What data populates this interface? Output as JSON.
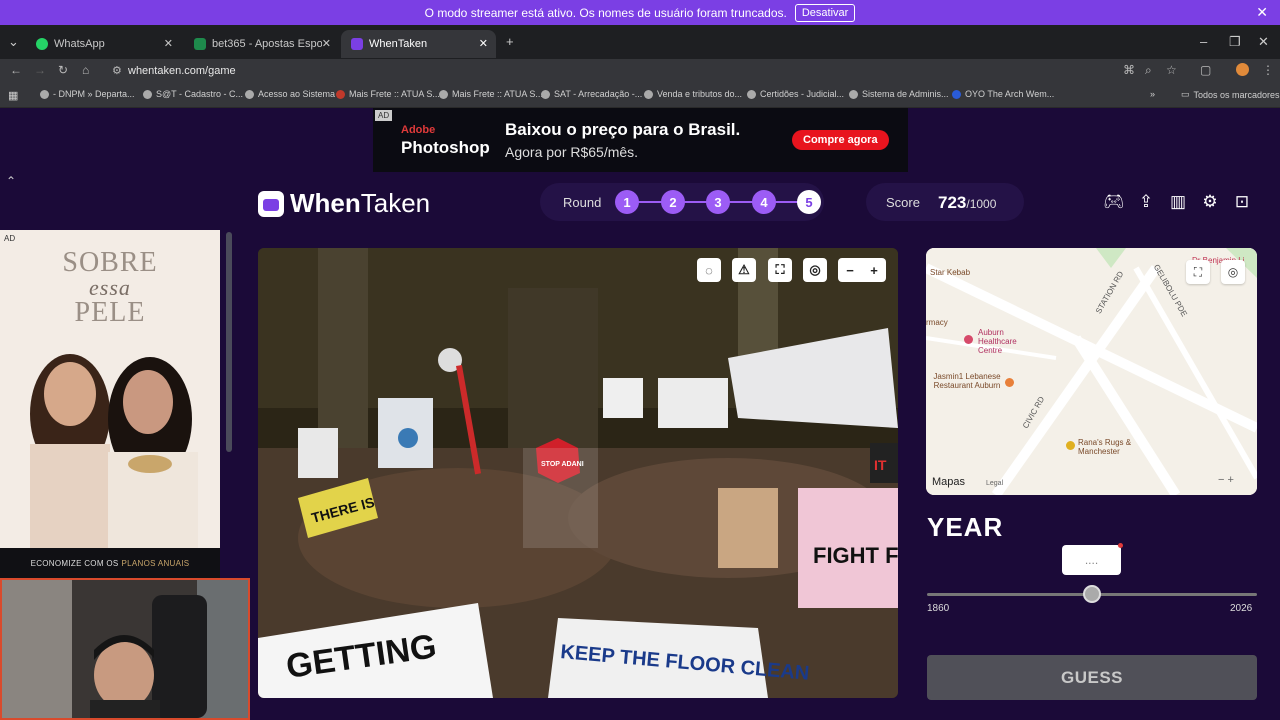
{
  "streamer": {
    "message": "O modo streamer está ativo. Os nomes de usuário foram truncados.",
    "button": "Desativar"
  },
  "tabs": [
    {
      "label": "WhatsApp",
      "color": "#25d366"
    },
    {
      "label": "bet365 - Apostas Esportivas Or",
      "color": "#1e8a4c"
    },
    {
      "label": "WhenTaken",
      "color": "#7b3fe4"
    }
  ],
  "url": "whentaken.com/game",
  "bookmarks": [
    "- DNPM » Departa...",
    "S@T - Cadastro - C...",
    "Acesso ao Sistema",
    "Mais Frete :: ATUA S...",
    "Mais Frete :: ATUA S...",
    "SAT - Arrecadação -...",
    "Venda e tributos do...",
    "Certidões - Judicial...",
    "Sistema de Adminis...",
    "OYO The Arch Wem...",
    "Todos os marcadores"
  ],
  "top_ad": {
    "ad_label": "AD",
    "brand_line1": "Adobe",
    "brand_line2": "Photoshop",
    "headline": "Baixou o preço para o Brasil.",
    "sub": "Agora por R$65/mês.",
    "cta": "Compre agora"
  },
  "logo": {
    "part1": "When",
    "part2": "Taken"
  },
  "round": {
    "label": "Round",
    "steps": [
      "1",
      "2",
      "3",
      "4",
      "5"
    ]
  },
  "score": {
    "label": "Score",
    "value": "723",
    "max": "/1000"
  },
  "left_ad": {
    "ad_label": "AD",
    "title1": "SOBRE",
    "title2": "essa",
    "title3": "PELE",
    "band": "ECONOMIZE COM OS",
    "band_highlight": "PLANOS ANUAIS"
  },
  "photo_placard_texts": [
    "THERE IS",
    "STOP ADANI",
    "KEEP THE FLOOR CLEAN",
    "GETTING",
    "FIGHT FOR",
    "IT"
  ],
  "map": {
    "labels": [
      "Star Kebab",
      "rmacy",
      "Auburn Healthcare Centre",
      "Jasmin1 Lebanese Restaurant Auburn",
      "Rana's Rugs & Manchester",
      "STATION RD",
      "GELIBOLU PDE",
      "CIVIC RD",
      "Dr Benjamin Li"
    ],
    "attribution": "Mapas",
    "legal": "Legal"
  },
  "year": {
    "label": "YEAR",
    "value": "....",
    "min": "1860",
    "max": "2026",
    "position": 0.5
  },
  "guess_button": "GUESS"
}
